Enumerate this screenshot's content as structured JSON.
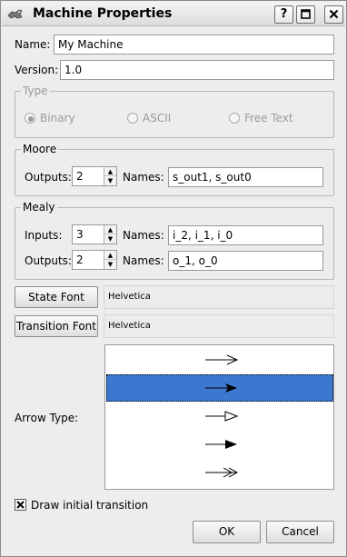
{
  "window": {
    "title": "Machine Properties"
  },
  "title_buttons": {
    "help": "?"
  },
  "name": {
    "label": "Name:",
    "value": "My Machine"
  },
  "version": {
    "label": "Version:",
    "value": "1.0"
  },
  "type": {
    "legend": "Type",
    "options": [
      "Binary",
      "ASCII",
      "Free Text"
    ],
    "selected": "Binary"
  },
  "moore": {
    "legend": "Moore",
    "outputs_label": "Outputs:",
    "outputs_value": "2",
    "names_label": "Names:",
    "names_value": "s_out1, s_out0"
  },
  "mealy": {
    "legend": "Mealy",
    "inputs_label": "Inputs:",
    "inputs_value": "3",
    "input_names_label": "Names:",
    "input_names_value": "i_2, i_1, i_0",
    "outputs_label": "Outputs:",
    "outputs_value": "2",
    "output_names_label": "Names:",
    "output_names_value": "o_1, o_0"
  },
  "state_font": {
    "button": "State Font",
    "value": "Helvetica"
  },
  "transition_font": {
    "button": "Transition Font",
    "value": "Helvetica"
  },
  "arrow_type": {
    "label": "Arrow Type:",
    "items": [
      "open-arrow",
      "filled-arrow",
      "hollow-triangle-arrow",
      "filled-triangle-arrow",
      "double-open-arrow"
    ],
    "selected_index": 1
  },
  "initial_transition": {
    "label": "Draw initial transition",
    "checked": true
  },
  "buttons": {
    "ok": "OK",
    "cancel": "Cancel"
  },
  "colors": {
    "selection": "#3c78d0",
    "background": "#ededed"
  }
}
